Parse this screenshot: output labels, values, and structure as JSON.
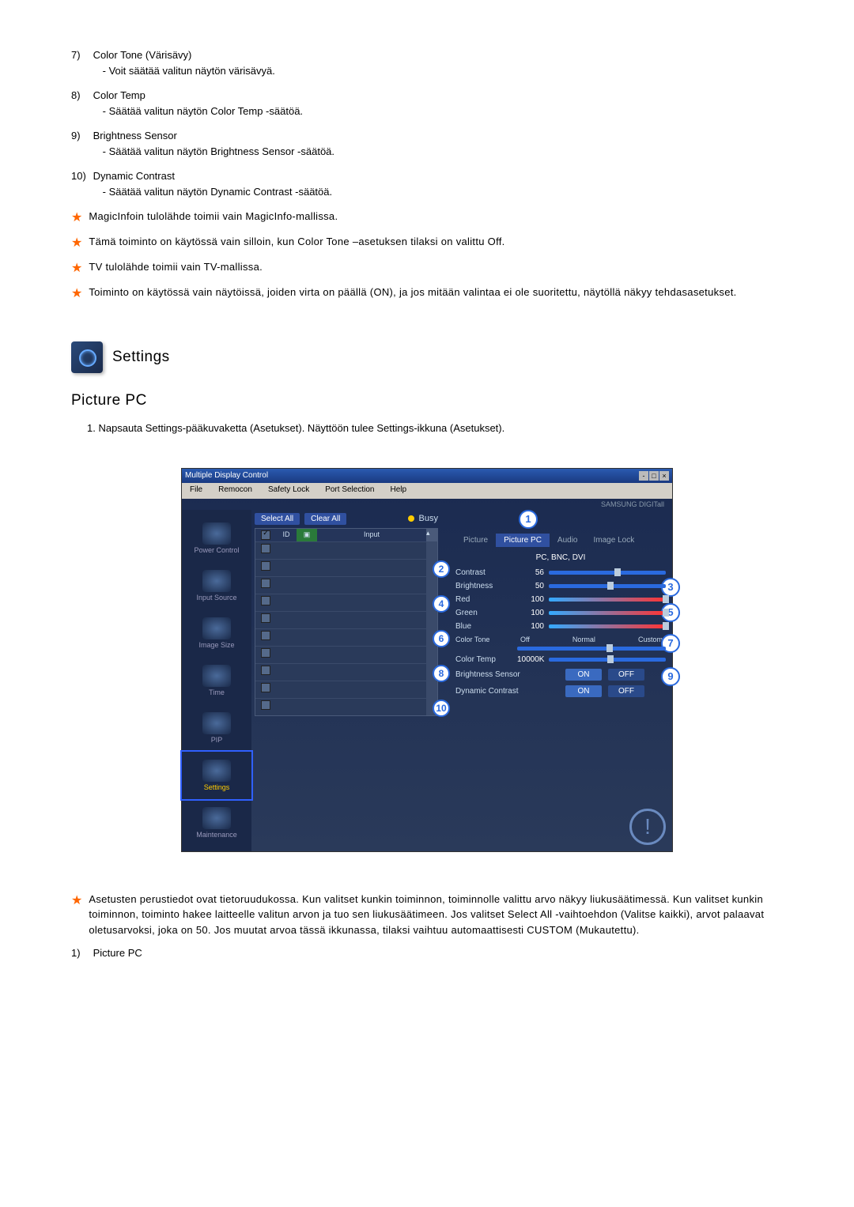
{
  "list": [
    {
      "num": "7)",
      "title": "Color Tone (Värisävy)",
      "desc": "- Voit säätää valitun näytön värisävyä."
    },
    {
      "num": "8)",
      "title": "Color Temp",
      "desc": "- Säätää valitun näytön Color Temp -säätöä."
    },
    {
      "num": "9)",
      "title": "Brightness Sensor",
      "desc": "- Säätää valitun näytön Brightness Sensor -säätöä."
    },
    {
      "num": "10)",
      "title": "Dynamic Contrast",
      "desc": "- Säätää valitun näytön Dynamic Contrast -säätöä."
    }
  ],
  "stars_top": [
    "MagicInfoin tulolähde toimii vain MagicInfo-mallissa.",
    "Tämä toiminto on käytössä vain silloin, kun Color Tone –asetuksen tilaksi on valittu Off.",
    "TV tulolähde toimii vain TV-mallissa.",
    "Toiminto on käytössä vain näytöissä, joiden virta on päällä (ON), ja jos mitään valintaa ei ole suoritettu, näytöllä näkyy tehdasasetukset."
  ],
  "settings_title": "Settings",
  "picture_pc_title": "Picture PC",
  "intro": "1. Napsauta Settings-pääkuvaketta (Asetukset). Näyttöön tulee Settings-ikkuna (Asetukset).",
  "app": {
    "title": "Multiple Display Control",
    "menus": [
      "File",
      "Remocon",
      "Safety Lock",
      "Port Selection",
      "Help"
    ],
    "brand": "SAMSUNG DIGITall",
    "nav": [
      "Power Control",
      "Input Source",
      "Image Size",
      "Time",
      "PIP",
      "Settings",
      "Maintenance"
    ],
    "select_all": "Select All",
    "clear_all": "Clear All",
    "busy": "Busy",
    "grid_headers": {
      "id": "ID",
      "input": "Input"
    },
    "tabs": [
      "Picture",
      "Picture PC",
      "Audio",
      "Image Lock"
    ],
    "subhead": "PC, BNC, DVI",
    "sliders": [
      {
        "label": "Contrast",
        "val": "56",
        "thumb": 56
      },
      {
        "label": "Brightness",
        "val": "50",
        "thumb": 50
      },
      {
        "label": "Red",
        "val": "100",
        "thumb": 100
      },
      {
        "label": "Green",
        "val": "100",
        "thumb": 100
      },
      {
        "label": "Blue",
        "val": "100",
        "thumb": 100
      }
    ],
    "color_tone": {
      "label": "Color Tone",
      "opts": [
        "Off",
        "Normal",
        "Custom"
      ]
    },
    "color_temp": {
      "label": "Color Temp",
      "val": "10000K"
    },
    "bsensor": {
      "label": "Brightness Sensor",
      "on": "ON",
      "off": "OFF"
    },
    "dcontrast": {
      "label": "Dynamic Contrast",
      "on": "ON",
      "off": "OFF"
    }
  },
  "stars_bottom": [
    "Asetusten perustiedot ovat tietoruudukossa. Kun valitset kunkin toiminnon, toiminnolle valittu arvo näkyy liukusäätimessä. Kun valitset kunkin toiminnon, toiminto hakee laitteelle valitun arvon ja tuo sen liukusäätimeen. Jos valitset Select All -vaihtoehdon (Valitse kaikki), arvot palaavat oletusarvoksi, joka on 50. Jos muutat arvoa tässä ikkunassa, tilaksi vaihtuu automaattisesti CUSTOM (Mukautettu)."
  ],
  "bottom_list": {
    "num": "1)",
    "title": "Picture PC"
  }
}
